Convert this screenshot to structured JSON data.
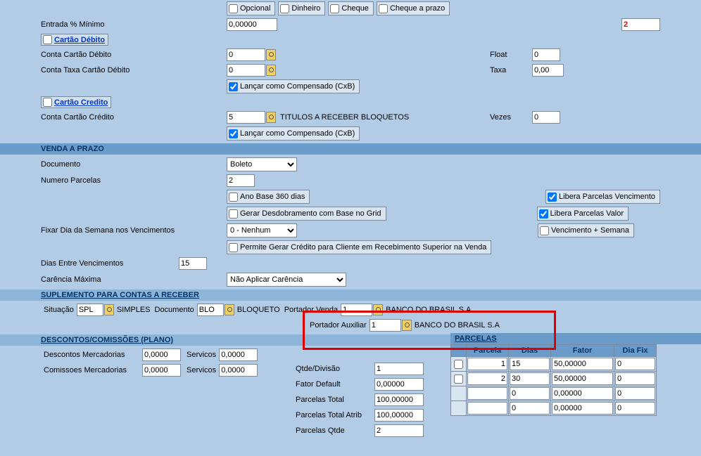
{
  "top": {
    "opcional": "Opcional",
    "dinheiro": "Dinheiro",
    "cheque": "Cheque",
    "cheque_prazo": "Cheque a prazo",
    "entrada_min": "Entrada % Mínimo",
    "entrada_val": "0,00000",
    "right_val": "2"
  },
  "debito": {
    "title": "Cartão Débito",
    "conta_label": "Conta Cartão Débito",
    "conta_val": "0",
    "float_label": "Float",
    "float_val": "0",
    "taxa_conta_label": "Conta Taxa Cartão Débito",
    "taxa_conta_val": "0",
    "taxa_label": "Taxa",
    "taxa_val": "0,00",
    "compensado": "Lançar como Compensado (CxB)"
  },
  "credito": {
    "title": "Cartão Credito",
    "conta_label": "Conta Cartão Crédito",
    "conta_val": "5",
    "conta_desc": "TITULOS A RECEBER BLOQUETOS",
    "vezes_label": "Vezes",
    "vezes_val": "0",
    "compensado": "Lançar como Compensado (CxB)"
  },
  "prazo": {
    "header": "VENDA A PRAZO",
    "documento_label": "Documento",
    "documento_val": "Boleto",
    "num_parc_label": "Numero Parcelas",
    "num_parc_val": "2",
    "ano_base": "Ano Base 360 dias",
    "libera_venc": "Libera Parcelas Vencimento",
    "gerar_desd": "Gerar Desdobramento com Base no Grid",
    "libera_valor": "Libera Parcelas Valor",
    "fixar_dia_label": "Fixar Dia da Semana nos Vencimentos",
    "fixar_dia_val": "0 - Nenhum",
    "venc_semana": "Vencimento + Semana",
    "permite_credito": "Permite Gerar Crédito para Cliente em Recebimento Superior na Venda",
    "dias_entre_label": "Dias Entre Vencimentos",
    "dias_entre_val": "15",
    "carencia_label": "Carência Máxima",
    "carencia_val": "Não Aplicar Carência"
  },
  "supl": {
    "header": "SUPLEMENTO PARA CONTAS A RECEBER",
    "situacao_label": "Situação",
    "situacao_val": "SPL",
    "situacao_desc": "SIMPLES",
    "documento_label": "Documento",
    "documento_val": "BLO",
    "documento_desc": "BLOQUETO",
    "port_venda_label": "Portador Venda",
    "port_venda_val": "1",
    "port_venda_desc": "BANCO DO BRASIL S.A",
    "port_aux_label": "Portador Auxiliar",
    "port_aux_val": "1",
    "port_aux_desc": "BANCO DO BRASIL S.A"
  },
  "desc": {
    "header": "DESCONTOS/COMISSÕES (PLANO)",
    "desc_merc_label": "Descontos Mercadorias",
    "desc_merc_val": "0,0000",
    "serv_label": "Servicos",
    "serv_val1": "0,0000",
    "com_merc_label": "Comissoes Mercadorias",
    "com_merc_val": "0,0000",
    "serv_val2": "0,0000"
  },
  "mid": {
    "qtde_div_label": "Qtde/Divisão",
    "qtde_div_val": "1",
    "fator_def_label": "Fator Default",
    "fator_def_val": "0,00000",
    "parc_total_label": "Parcelas Total",
    "parc_total_val": "100,00000",
    "parc_atrib_label": "Parcelas Total Atrib",
    "parc_atrib_val": "100,00000",
    "parc_qtde_label": "Parcelas Qtde",
    "parc_qtde_val": "2"
  },
  "parcelas": {
    "header": "PARCELAS",
    "cols": {
      "c1": "",
      "c2": "Parcela",
      "c3": "Dias",
      "c4": "Fator",
      "c5": "Dia Fix"
    },
    "rows": [
      {
        "chk": true,
        "parcela": "1",
        "dias": "15",
        "fator": "50,00000",
        "diafix": "0"
      },
      {
        "chk": true,
        "parcela": "2",
        "dias": "30",
        "fator": "50,00000",
        "diafix": "0"
      },
      {
        "chk": false,
        "parcela": "",
        "dias": "0",
        "fator": "0,00000",
        "diafix": "0"
      },
      {
        "chk": false,
        "parcela": "",
        "dias": "0",
        "fator": "0,00000",
        "diafix": "0"
      }
    ]
  }
}
